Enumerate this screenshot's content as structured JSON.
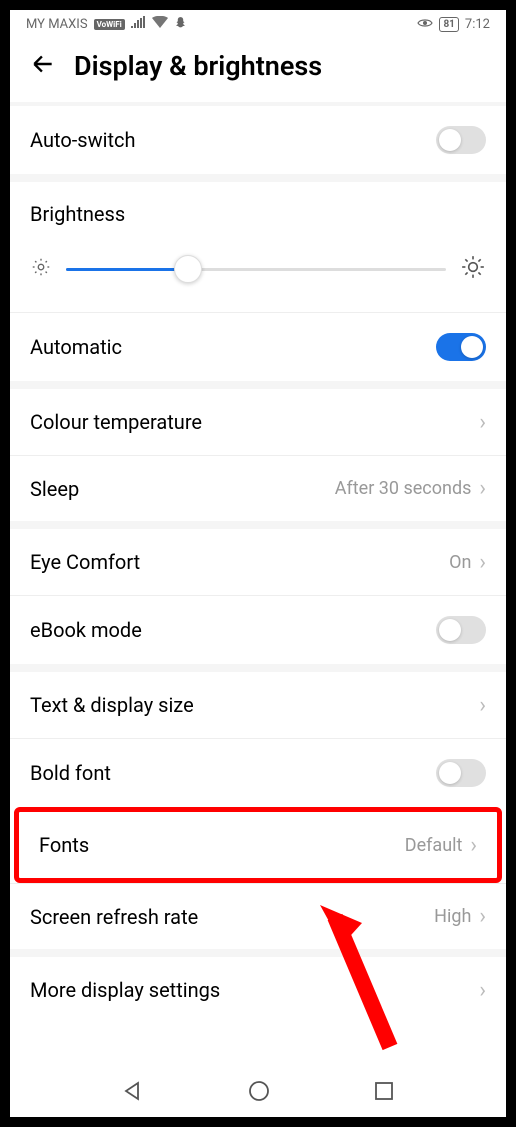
{
  "statusBar": {
    "carrier": "MY MAXIS",
    "vowifi": "VoWiFi",
    "battery": "81",
    "time": "7:12"
  },
  "header": {
    "title": "Display & brightness"
  },
  "rows": {
    "autoSwitch": {
      "label": "Auto-switch",
      "on": false
    },
    "brightness": {
      "label": "Brightness",
      "percent": 32
    },
    "automatic": {
      "label": "Automatic",
      "on": true
    },
    "colourTemp": {
      "label": "Colour temperature"
    },
    "sleep": {
      "label": "Sleep",
      "value": "After 30 seconds"
    },
    "eyeComfort": {
      "label": "Eye Comfort",
      "value": "On"
    },
    "ebook": {
      "label": "eBook mode",
      "on": false
    },
    "textSize": {
      "label": "Text & display size"
    },
    "boldFont": {
      "label": "Bold font",
      "on": false
    },
    "fonts": {
      "label": "Fonts",
      "value": "Default"
    },
    "refreshRate": {
      "label": "Screen refresh rate",
      "value": "High"
    },
    "moreSettings": {
      "label": "More display settings"
    }
  }
}
